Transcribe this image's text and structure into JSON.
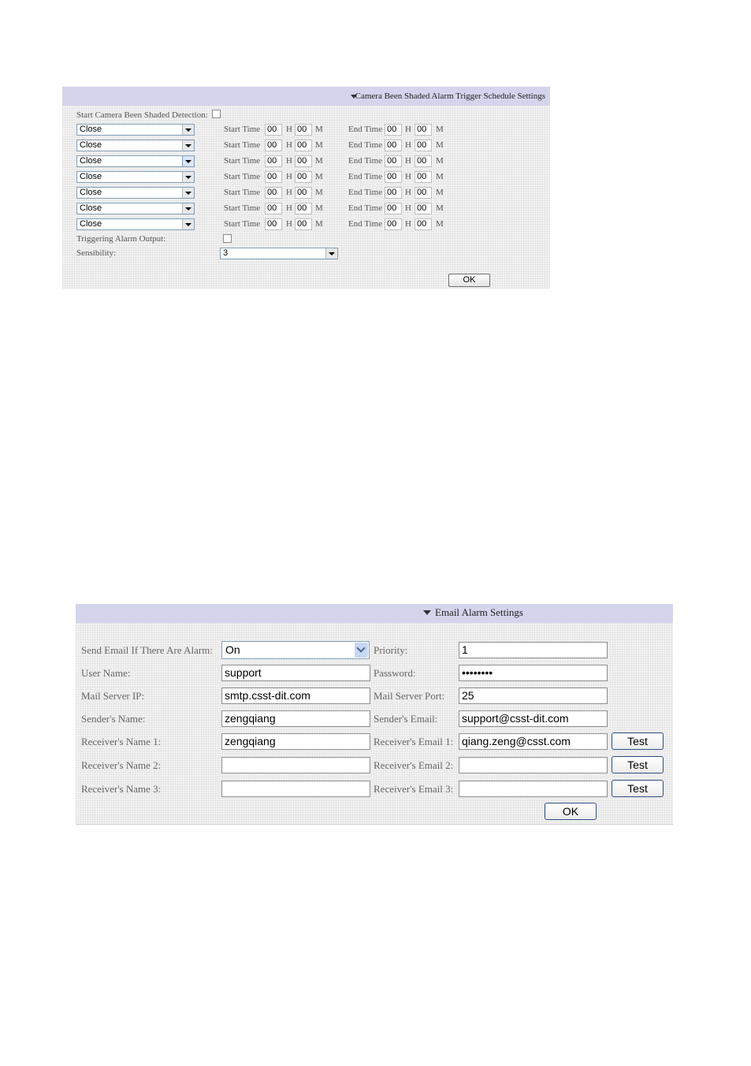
{
  "schedule_panel": {
    "title": "Camera Been Shaded Alarm Trigger Schedule Settings",
    "start_detection_label": "Start Camera Been Shaded Detection:",
    "start_detection_checked": false,
    "rows": [
      {
        "day_value": "Close",
        "start_label": "Start Time",
        "start_h": "00",
        "h_unit": "H",
        "start_m": "00",
        "m_unit": "M",
        "end_label": "End Time",
        "end_h": "00",
        "end_m": "00"
      },
      {
        "day_value": "Close",
        "start_label": "Start Time",
        "start_h": "00",
        "h_unit": "H",
        "start_m": "00",
        "m_unit": "M",
        "end_label": "End Time",
        "end_h": "00",
        "end_m": "00"
      },
      {
        "day_value": "Close",
        "start_label": "Start Time",
        "start_h": "00",
        "h_unit": "H",
        "start_m": "00",
        "m_unit": "M",
        "end_label": "End Time",
        "end_h": "00",
        "end_m": "00"
      },
      {
        "day_value": "Close",
        "start_label": "Start Time",
        "start_h": "00",
        "h_unit": "H",
        "start_m": "00",
        "m_unit": "M",
        "end_label": "End Time",
        "end_h": "00",
        "end_m": "00"
      },
      {
        "day_value": "Close",
        "start_label": "Start Time",
        "start_h": "00",
        "h_unit": "H",
        "start_m": "00",
        "m_unit": "M",
        "end_label": "End Time",
        "end_h": "00",
        "end_m": "00"
      },
      {
        "day_value": "Close",
        "start_label": "Start Time",
        "start_h": "00",
        "h_unit": "H",
        "start_m": "00",
        "m_unit": "M",
        "end_label": "End Time",
        "end_h": "00",
        "end_m": "00"
      },
      {
        "day_value": "Close",
        "start_label": "Start Time",
        "start_h": "00",
        "h_unit": "H",
        "start_m": "00",
        "m_unit": "M",
        "end_label": "End Time",
        "end_h": "00",
        "end_m": "00"
      }
    ],
    "triggering_label": "Triggering Alarm Output:",
    "triggering_checked": false,
    "sensibility_label": "Sensibility:",
    "sensibility_value": "3",
    "ok_label": "OK"
  },
  "email_panel": {
    "title": "Email Alarm Settings",
    "send_email_label": "Send Email If There Are Alarm:",
    "send_email_value": "On",
    "priority_label": "Priority:",
    "priority_value": "1",
    "user_name_label": "User Name:",
    "user_name_value": "support",
    "password_label": "Password:",
    "password_value": "••••••••",
    "mail_server_ip_label": "Mail Server IP:",
    "mail_server_ip_value": "smtp.csst-dit.com",
    "mail_server_port_label": "Mail Server Port:",
    "mail_server_port_value": "25",
    "sender_name_label": "Sender's Name:",
    "sender_name_value": "zengqiang",
    "sender_email_label": "Sender's Email:",
    "sender_email_value": "support@csst-dit.com",
    "receivers": [
      {
        "name_label": "Receiver's Name 1:",
        "name_value": "zengqiang",
        "email_label": "Receiver's Email 1:",
        "email_value": "qiang.zeng@csst.com",
        "test_label": "Test"
      },
      {
        "name_label": "Receiver's Name 2:",
        "name_value": "",
        "email_label": "Receiver's Email 2:",
        "email_value": "",
        "test_label": "Test"
      },
      {
        "name_label": "Receiver's Name 3:",
        "name_value": "",
        "email_label": "Receiver's Email 3:",
        "email_value": "",
        "test_label": "Test"
      }
    ],
    "ok_label": "OK"
  }
}
